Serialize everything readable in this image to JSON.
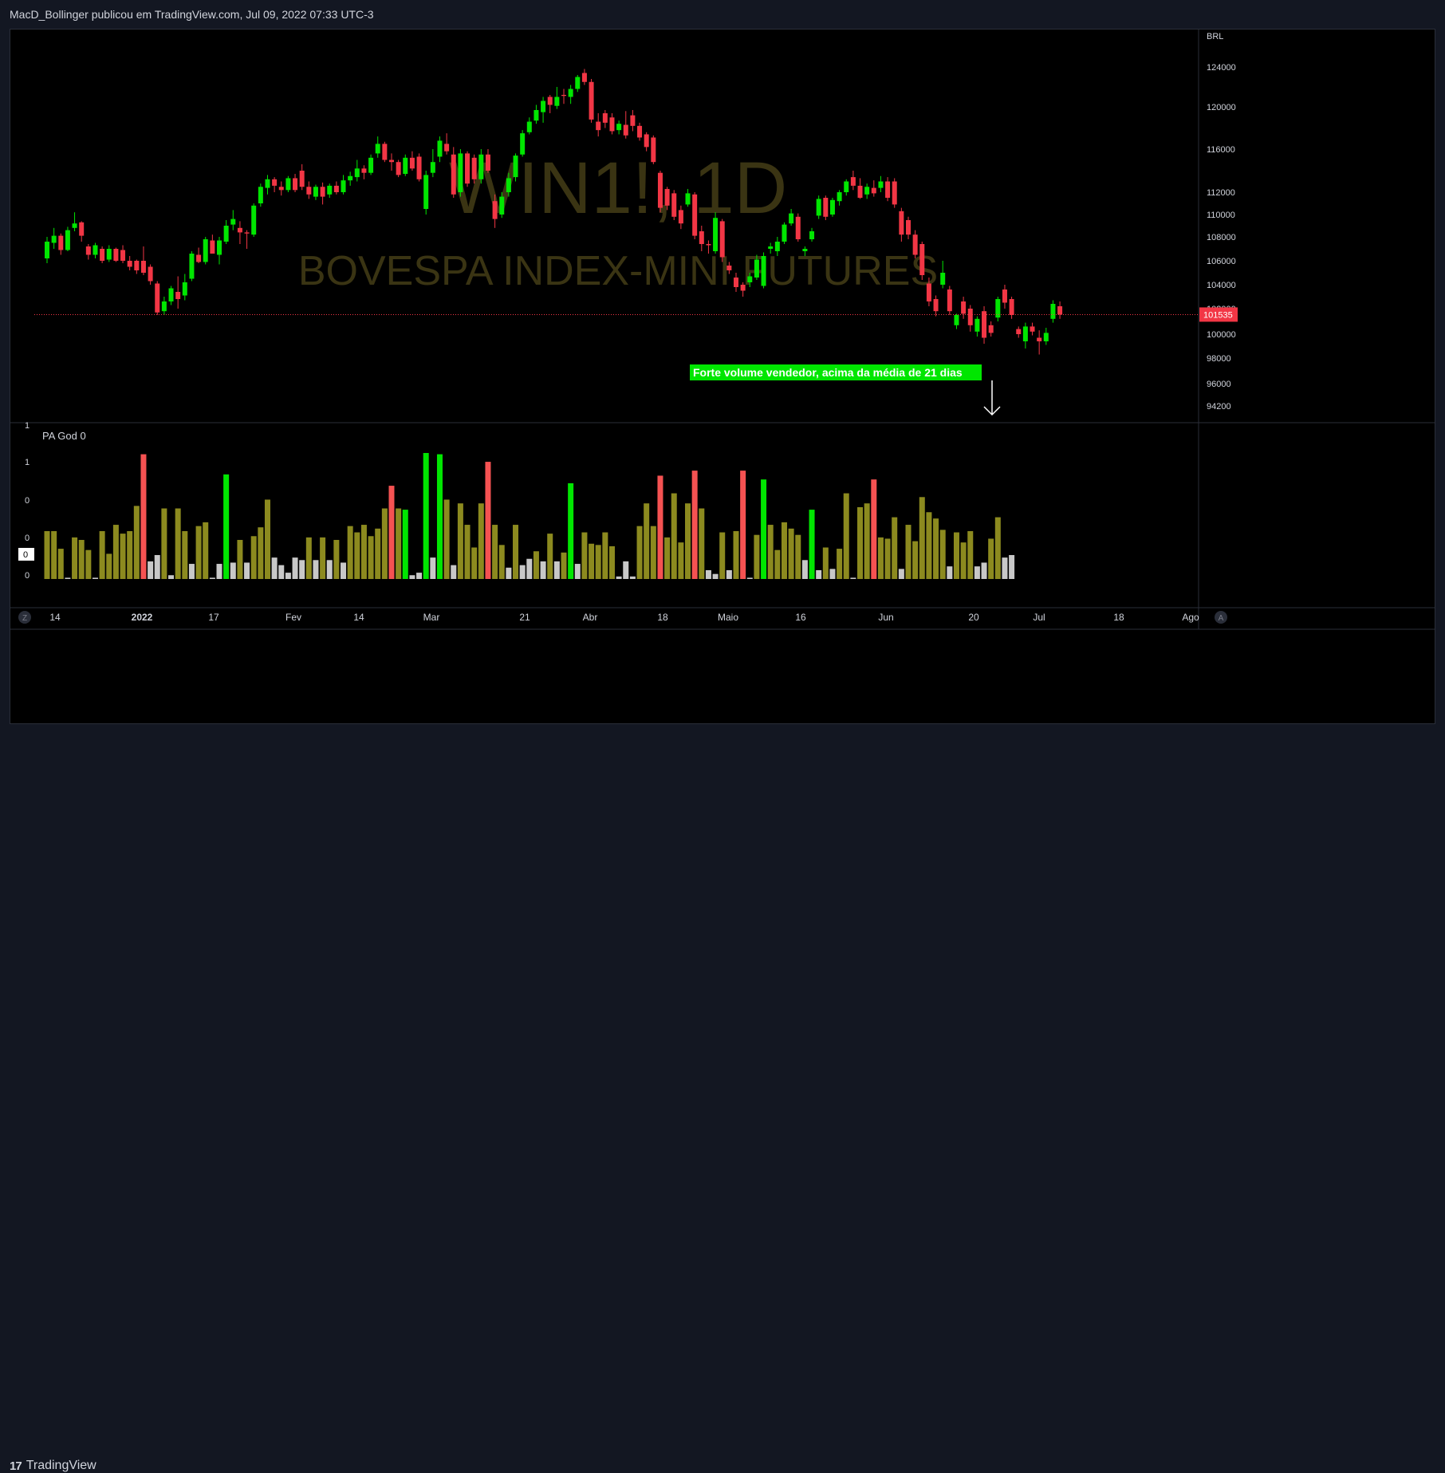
{
  "header": {
    "published_by": "MacD_Bollinger publicou em TradingView.com, Jul 09, 2022 07:33 UTC-3"
  },
  "watermark": {
    "symbol": "WIN1!, 1D",
    "name": "BOVESPA INDEX-MINI FUTURES"
  },
  "price_axis": {
    "currency": "BRL",
    "ticks": [
      "124000",
      "120000",
      "116000",
      "112000",
      "110000",
      "108000",
      "106000",
      "104000",
      "102000",
      "100000",
      "98000",
      "96000",
      "94200"
    ],
    "last_price": "101535",
    "last_price_color": "#f23645"
  },
  "time_axis": {
    "labels": [
      "14",
      "2022",
      "17",
      "Fev",
      "14",
      "Mar",
      "21",
      "Abr",
      "18",
      "Maio",
      "16",
      "Jun",
      "20",
      "Jul",
      "18",
      "Ago"
    ]
  },
  "annotation": {
    "text": "Forte volume vendedor, acima da média de 21 dias",
    "bg_color": "#00e600"
  },
  "indicator": {
    "name": "PA God",
    "value": "0",
    "axis_labels": [
      "1",
      "1",
      "0",
      "0",
      "0",
      "0"
    ],
    "current_value": "0"
  },
  "colors": {
    "up": "#00e600",
    "down": "#f23645",
    "vol_normal": "#8c8a1f",
    "vol_low": "#c8c8c8",
    "vol_high_up": "#00e600",
    "vol_high_down": "#f55252"
  },
  "footer": {
    "brand": "TradingView",
    "left_button": "Z",
    "right_button": "A"
  },
  "chart_data": {
    "type": "candlestick",
    "ylim": [
      93000,
      126000
    ],
    "candles": [
      {
        "o": 106200,
        "h": 108000,
        "l": 105800,
        "c": 107600
      },
      {
        "o": 107500,
        "h": 108800,
        "l": 107000,
        "c": 108100
      },
      {
        "o": 108100,
        "h": 108300,
        "l": 106500,
        "c": 106900
      },
      {
        "o": 106900,
        "h": 108900,
        "l": 106800,
        "c": 108600
      },
      {
        "o": 108800,
        "h": 110200,
        "l": 108500,
        "c": 109200
      },
      {
        "o": 109300,
        "h": 109400,
        "l": 107600,
        "c": 108100
      },
      {
        "o": 107200,
        "h": 107400,
        "l": 106100,
        "c": 106500
      },
      {
        "o": 106500,
        "h": 107500,
        "l": 106200,
        "c": 107300
      },
      {
        "o": 107000,
        "h": 107200,
        "l": 105800,
        "c": 106000
      },
      {
        "o": 106100,
        "h": 107300,
        "l": 105900,
        "c": 107000
      },
      {
        "o": 107000,
        "h": 107100,
        "l": 105900,
        "c": 106000
      },
      {
        "o": 106900,
        "h": 107300,
        "l": 105800,
        "c": 106000
      },
      {
        "o": 106000,
        "h": 106400,
        "l": 105200,
        "c": 105500
      },
      {
        "o": 106000,
        "h": 106100,
        "l": 104900,
        "c": 105200
      },
      {
        "o": 106000,
        "h": 107200,
        "l": 104800,
        "c": 105000
      },
      {
        "o": 105500,
        "h": 105700,
        "l": 104000,
        "c": 104300
      },
      {
        "o": 104100,
        "h": 104300,
        "l": 101500,
        "c": 101700
      },
      {
        "o": 101800,
        "h": 103000,
        "l": 101500,
        "c": 102600
      },
      {
        "o": 102600,
        "h": 103900,
        "l": 102300,
        "c": 103700
      },
      {
        "o": 103400,
        "h": 104700,
        "l": 102000,
        "c": 102800
      },
      {
        "o": 103100,
        "h": 104900,
        "l": 102700,
        "c": 104200
      },
      {
        "o": 104500,
        "h": 106800,
        "l": 104300,
        "c": 106600
      },
      {
        "o": 106500,
        "h": 107100,
        "l": 105800,
        "c": 105900
      },
      {
        "o": 105900,
        "h": 108000,
        "l": 105700,
        "c": 107800
      },
      {
        "o": 107700,
        "h": 108200,
        "l": 106600,
        "c": 106600
      },
      {
        "o": 106500,
        "h": 108000,
        "l": 105700,
        "c": 107700
      },
      {
        "o": 107600,
        "h": 109500,
        "l": 107400,
        "c": 109000
      },
      {
        "o": 109100,
        "h": 110400,
        "l": 108600,
        "c": 109600
      },
      {
        "o": 108800,
        "h": 109400,
        "l": 107400,
        "c": 108400
      },
      {
        "o": 108400,
        "h": 108600,
        "l": 107000,
        "c": 108300
      },
      {
        "o": 108200,
        "h": 111000,
        "l": 108000,
        "c": 110800
      },
      {
        "o": 111000,
        "h": 112800,
        "l": 110700,
        "c": 112500
      },
      {
        "o": 112400,
        "h": 113600,
        "l": 111800,
        "c": 113200
      },
      {
        "o": 113200,
        "h": 113400,
        "l": 112000,
        "c": 112600
      },
      {
        "o": 112500,
        "h": 113000,
        "l": 111700,
        "c": 112200
      },
      {
        "o": 112200,
        "h": 113500,
        "l": 112000,
        "c": 113300
      },
      {
        "o": 113300,
        "h": 113700,
        "l": 112000,
        "c": 112200
      },
      {
        "o": 114000,
        "h": 114600,
        "l": 112200,
        "c": 112500
      },
      {
        "o": 112500,
        "h": 113000,
        "l": 111400,
        "c": 111800
      },
      {
        "o": 111600,
        "h": 112700,
        "l": 111300,
        "c": 112500
      },
      {
        "o": 112500,
        "h": 112900,
        "l": 110900,
        "c": 111600
      },
      {
        "o": 111800,
        "h": 112800,
        "l": 111500,
        "c": 112600
      },
      {
        "o": 112600,
        "h": 113000,
        "l": 111800,
        "c": 112000
      },
      {
        "o": 112000,
        "h": 113600,
        "l": 111800,
        "c": 113100
      },
      {
        "o": 113100,
        "h": 113900,
        "l": 112600,
        "c": 113500
      },
      {
        "o": 113400,
        "h": 115000,
        "l": 113000,
        "c": 114200
      },
      {
        "o": 114200,
        "h": 114500,
        "l": 113200,
        "c": 113800
      },
      {
        "o": 113800,
        "h": 115500,
        "l": 113600,
        "c": 115200
      },
      {
        "o": 115600,
        "h": 117200,
        "l": 115200,
        "c": 116500
      },
      {
        "o": 116500,
        "h": 116700,
        "l": 114800,
        "c": 115000
      },
      {
        "o": 115000,
        "h": 115600,
        "l": 114000,
        "c": 114800
      },
      {
        "o": 114800,
        "h": 115000,
        "l": 113400,
        "c": 113600
      },
      {
        "o": 113700,
        "h": 115500,
        "l": 113500,
        "c": 115200
      },
      {
        "o": 115200,
        "h": 115800,
        "l": 114000,
        "c": 114200
      },
      {
        "o": 115300,
        "h": 115600,
        "l": 113000,
        "c": 113200
      },
      {
        "o": 110500,
        "h": 114000,
        "l": 110000,
        "c": 113600
      },
      {
        "o": 113800,
        "h": 116000,
        "l": 113400,
        "c": 114800
      },
      {
        "o": 115300,
        "h": 117200,
        "l": 114800,
        "c": 116800
      },
      {
        "o": 116500,
        "h": 117500,
        "l": 115500,
        "c": 115800
      },
      {
        "o": 115500,
        "h": 116200,
        "l": 111500,
        "c": 111800
      },
      {
        "o": 112000,
        "h": 116000,
        "l": 111600,
        "c": 115600
      },
      {
        "o": 115600,
        "h": 115800,
        "l": 112500,
        "c": 112800
      },
      {
        "o": 115200,
        "h": 115500,
        "l": 112800,
        "c": 113200
      },
      {
        "o": 113200,
        "h": 116000,
        "l": 112800,
        "c": 115500
      },
      {
        "o": 115500,
        "h": 116000,
        "l": 113800,
        "c": 114000
      },
      {
        "o": 111200,
        "h": 111800,
        "l": 108800,
        "c": 109600
      },
      {
        "o": 110000,
        "h": 112000,
        "l": 109700,
        "c": 111600
      },
      {
        "o": 112000,
        "h": 113800,
        "l": 111600,
        "c": 113300
      },
      {
        "o": 113400,
        "h": 115600,
        "l": 113000,
        "c": 115400
      },
      {
        "o": 115500,
        "h": 117800,
        "l": 115300,
        "c": 117500
      },
      {
        "o": 117600,
        "h": 119000,
        "l": 117400,
        "c": 118600
      },
      {
        "o": 118700,
        "h": 120200,
        "l": 118400,
        "c": 119700
      },
      {
        "o": 119500,
        "h": 121000,
        "l": 118500,
        "c": 120600
      },
      {
        "o": 121000,
        "h": 121200,
        "l": 119400,
        "c": 120200
      },
      {
        "o": 120100,
        "h": 122000,
        "l": 119800,
        "c": 121000
      },
      {
        "o": 121200,
        "h": 121800,
        "l": 120300,
        "c": 121100
      },
      {
        "o": 121000,
        "h": 122200,
        "l": 120300,
        "c": 121800
      },
      {
        "o": 121800,
        "h": 123200,
        "l": 121500,
        "c": 123000
      },
      {
        "o": 123400,
        "h": 123800,
        "l": 122200,
        "c": 122500
      },
      {
        "o": 122500,
        "h": 122800,
        "l": 118500,
        "c": 118800
      },
      {
        "o": 118600,
        "h": 119400,
        "l": 117200,
        "c": 117800
      },
      {
        "o": 119400,
        "h": 119700,
        "l": 118000,
        "c": 118500
      },
      {
        "o": 119000,
        "h": 119400,
        "l": 117400,
        "c": 117700
      },
      {
        "o": 117800,
        "h": 118700,
        "l": 117400,
        "c": 118400
      },
      {
        "o": 118300,
        "h": 119600,
        "l": 117000,
        "c": 117300
      },
      {
        "o": 119200,
        "h": 119700,
        "l": 117700,
        "c": 118200
      },
      {
        "o": 118200,
        "h": 118500,
        "l": 116800,
        "c": 117100
      },
      {
        "o": 117400,
        "h": 117600,
        "l": 115800,
        "c": 116200
      },
      {
        "o": 117100,
        "h": 117300,
        "l": 114600,
        "c": 114800
      },
      {
        "o": 113800,
        "h": 114000,
        "l": 110200,
        "c": 110600
      },
      {
        "o": 112300,
        "h": 112500,
        "l": 110400,
        "c": 110800
      },
      {
        "o": 111900,
        "h": 112200,
        "l": 109500,
        "c": 109800
      },
      {
        "o": 110400,
        "h": 110800,
        "l": 108700,
        "c": 109200
      },
      {
        "o": 110900,
        "h": 112300,
        "l": 110700,
        "c": 111900
      },
      {
        "o": 111800,
        "h": 112000,
        "l": 107800,
        "c": 108100
      },
      {
        "o": 108500,
        "h": 109000,
        "l": 106800,
        "c": 107400
      },
      {
        "o": 107400,
        "h": 107700,
        "l": 106600,
        "c": 107300
      },
      {
        "o": 106800,
        "h": 110200,
        "l": 106600,
        "c": 109700
      },
      {
        "o": 109400,
        "h": 109600,
        "l": 105900,
        "c": 106300
      },
      {
        "o": 105600,
        "h": 105900,
        "l": 104900,
        "c": 105200
      },
      {
        "o": 104600,
        "h": 105000,
        "l": 103400,
        "c": 103800
      },
      {
        "o": 104000,
        "h": 104200,
        "l": 103000,
        "c": 103500
      },
      {
        "o": 104200,
        "h": 105000,
        "l": 103800,
        "c": 104700
      },
      {
        "o": 104600,
        "h": 106500,
        "l": 104400,
        "c": 106100
      },
      {
        "o": 103900,
        "h": 106700,
        "l": 103700,
        "c": 106400
      },
      {
        "o": 107000,
        "h": 107500,
        "l": 106600,
        "c": 107200
      },
      {
        "o": 106800,
        "h": 108000,
        "l": 106400,
        "c": 107600
      },
      {
        "o": 107600,
        "h": 109300,
        "l": 107400,
        "c": 109100
      },
      {
        "o": 109200,
        "h": 110500,
        "l": 109000,
        "c": 110100
      },
      {
        "o": 109800,
        "h": 110100,
        "l": 107600,
        "c": 107800
      },
      {
        "o": 106800,
        "h": 107200,
        "l": 106400,
        "c": 107000
      },
      {
        "o": 107800,
        "h": 108800,
        "l": 107600,
        "c": 108500
      },
      {
        "o": 109900,
        "h": 111700,
        "l": 109600,
        "c": 111400
      },
      {
        "o": 111500,
        "h": 111700,
        "l": 109500,
        "c": 109800
      },
      {
        "o": 110000,
        "h": 111500,
        "l": 109800,
        "c": 111300
      },
      {
        "o": 111200,
        "h": 112200,
        "l": 110800,
        "c": 112000
      },
      {
        "o": 112000,
        "h": 113200,
        "l": 111700,
        "c": 113000
      },
      {
        "o": 113400,
        "h": 114000,
        "l": 112200,
        "c": 112600
      },
      {
        "o": 112600,
        "h": 113300,
        "l": 111400,
        "c": 111500
      },
      {
        "o": 111800,
        "h": 112800,
        "l": 111400,
        "c": 112500
      },
      {
        "o": 112400,
        "h": 113100,
        "l": 111600,
        "c": 111900
      },
      {
        "o": 112400,
        "h": 113500,
        "l": 112000,
        "c": 113000
      },
      {
        "o": 113000,
        "h": 113400,
        "l": 111200,
        "c": 111500
      },
      {
        "o": 113000,
        "h": 113300,
        "l": 110600,
        "c": 110900
      },
      {
        "o": 110300,
        "h": 110600,
        "l": 107600,
        "c": 108200
      },
      {
        "o": 109500,
        "h": 109800,
        "l": 107800,
        "c": 108200
      },
      {
        "o": 108200,
        "h": 108600,
        "l": 106200,
        "c": 106500
      },
      {
        "o": 107400,
        "h": 107600,
        "l": 104400,
        "c": 104800
      },
      {
        "o": 104100,
        "h": 104600,
        "l": 102200,
        "c": 102600
      },
      {
        "o": 102800,
        "h": 103100,
        "l": 101400,
        "c": 101800
      },
      {
        "o": 104000,
        "h": 106000,
        "l": 103700,
        "c": 105000
      },
      {
        "o": 103600,
        "h": 103900,
        "l": 101500,
        "c": 101800
      },
      {
        "o": 100700,
        "h": 101600,
        "l": 100400,
        "c": 101500
      },
      {
        "o": 102600,
        "h": 103000,
        "l": 101200,
        "c": 101600
      },
      {
        "o": 102000,
        "h": 102300,
        "l": 100200,
        "c": 100700
      },
      {
        "o": 100200,
        "h": 101400,
        "l": 99800,
        "c": 101200
      },
      {
        "o": 101800,
        "h": 102200,
        "l": 99200,
        "c": 99700
      },
      {
        "o": 100700,
        "h": 101000,
        "l": 99800,
        "c": 100100
      },
      {
        "o": 101300,
        "h": 103000,
        "l": 101000,
        "c": 102800
      },
      {
        "o": 103600,
        "h": 104000,
        "l": 102000,
        "c": 102500
      },
      {
        "o": 102800,
        "h": 103000,
        "l": 101200,
        "c": 101500
      },
      {
        "o": 100400,
        "h": 100600,
        "l": 99700,
        "c": 100000
      },
      {
        "o": 99400,
        "h": 100900,
        "l": 98800,
        "c": 100600
      },
      {
        "o": 100600,
        "h": 100900,
        "l": 99900,
        "c": 100200
      },
      {
        "o": 99700,
        "h": 100300,
        "l": 98300,
        "c": 99400
      },
      {
        "o": 99400,
        "h": 100500,
        "l": 99100,
        "c": 100100
      },
      {
        "o": 101200,
        "h": 102700,
        "l": 100900,
        "c": 102400
      },
      {
        "o": 102200,
        "h": 102600,
        "l": 101200,
        "c": 101535
      }
    ],
    "volume_levels": [
      0.38,
      0.38,
      0.24,
      0.01,
      0.33,
      0.31,
      0.23,
      0.01,
      0.38,
      0.2,
      0.43,
      0.36,
      0.38,
      0.58,
      0.99,
      0.14,
      0.19,
      0.56,
      0.03,
      0.56,
      0.38,
      0.12,
      0.42,
      0.45,
      0.01,
      0.12,
      0.83,
      0.13,
      0.31,
      0.13,
      0.34,
      0.41,
      0.63,
      0.17,
      0.11,
      0.05,
      0.17,
      0.15,
      0.33,
      0.15,
      0.33,
      0.15,
      0.31,
      0.13,
      0.42,
      0.37,
      0.43,
      0.34,
      0.4,
      0.56,
      0.74,
      0.56,
      0.55,
      0.03,
      0.05,
      1.0,
      0.17,
      0.99,
      0.63,
      0.11,
      0.6,
      0.43,
      0.25,
      0.6,
      0.93,
      0.43,
      0.27,
      0.09,
      0.43,
      0.11,
      0.16,
      0.22,
      0.14,
      0.36,
      0.14,
      0.21,
      0.76,
      0.12,
      0.37,
      0.28,
      0.27,
      0.37,
      0.26,
      0.02,
      0.14,
      0.02,
      0.42,
      0.6,
      0.42,
      0.82,
      0.33,
      0.68,
      0.29,
      0.6,
      0.86,
      0.56,
      0.07,
      0.04,
      0.37,
      0.07,
      0.38,
      0.86,
      0.01,
      0.35,
      0.79,
      0.43,
      0.23,
      0.45,
      0.4,
      0.35,
      0.15,
      0.55,
      0.07,
      0.25,
      0.08,
      0.24,
      0.68,
      0.01,
      0.57,
      0.6,
      0.79,
      0.33,
      0.32,
      0.49,
      0.08,
      0.43,
      0.3,
      0.65,
      0.53,
      0.48,
      0.39,
      0.1,
      0.37,
      0.29,
      0.38,
      0.1,
      0.13,
      0.32,
      0.49,
      0.17,
      0.19
    ]
  }
}
